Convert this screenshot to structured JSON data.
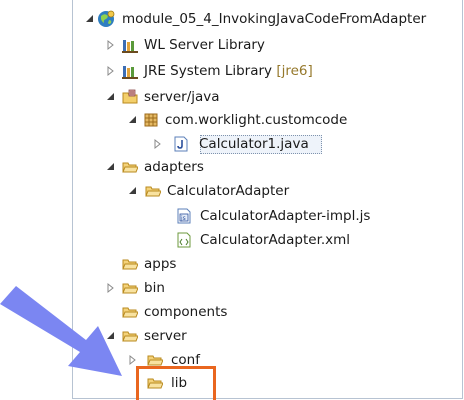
{
  "accent": {
    "highlight_box": "#e9661f",
    "arrow": "#7b86f2",
    "folder": "#e9b341"
  },
  "tree": [
    {
      "label": "module_05_4_InvokingJavaCodeFromAdapter",
      "icon": "project-globe-icon",
      "twisty": "expanded"
    },
    {
      "label": "WL Server Library",
      "icon": "library-icon",
      "twisty": "collapsed"
    },
    {
      "label": "JRE System Library",
      "decoration": "[jre6]",
      "icon": "library-icon",
      "twisty": "collapsed"
    },
    {
      "label": "server/java",
      "icon": "source-folder-icon",
      "twisty": "expanded"
    },
    {
      "label": "com.worklight.customcode",
      "icon": "package-icon",
      "twisty": "expanded"
    },
    {
      "label": "Calculator1.java",
      "icon": "java-file-icon",
      "twisty": "collapsed",
      "selected": true
    },
    {
      "label": "adapters",
      "icon": "folder-icon",
      "twisty": "expanded"
    },
    {
      "label": "CalculatorAdapter",
      "icon": "folder-icon",
      "twisty": "expanded"
    },
    {
      "label": "CalculatorAdapter-impl.js",
      "icon": "js-file-icon",
      "twisty": "none"
    },
    {
      "label": "CalculatorAdapter.xml",
      "icon": "xml-file-icon",
      "twisty": "none"
    },
    {
      "label": "apps",
      "icon": "folder-icon",
      "twisty": "none"
    },
    {
      "label": "bin",
      "icon": "folder-icon",
      "twisty": "collapsed"
    },
    {
      "label": "components",
      "icon": "folder-icon",
      "twisty": "none"
    },
    {
      "label": "server",
      "icon": "folder-icon",
      "twisty": "expanded"
    },
    {
      "label": "conf",
      "icon": "folder-icon",
      "twisty": "collapsed"
    },
    {
      "label": "lib",
      "icon": "folder-icon",
      "twisty": "none"
    }
  ]
}
